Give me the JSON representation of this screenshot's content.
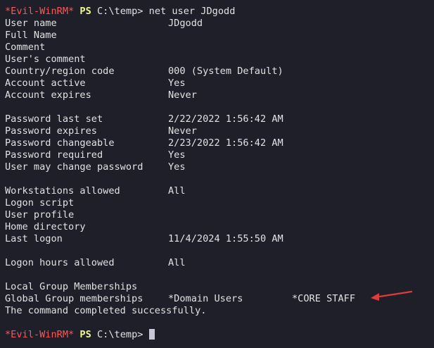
{
  "prompt": {
    "host": "*Evil-WinRM*",
    "shell": "PS",
    "path": "C:\\temp>"
  },
  "command": "net user JDgodd",
  "rows": [
    {
      "label": "User name",
      "value": "JDgodd"
    },
    {
      "label": "Full Name",
      "value": ""
    },
    {
      "label": "Comment",
      "value": ""
    },
    {
      "label": "User's comment",
      "value": ""
    },
    {
      "label": "Country/region code",
      "value": "000 (System Default)"
    },
    {
      "label": "Account active",
      "value": "Yes"
    },
    {
      "label": "Account expires",
      "value": "Never"
    },
    {
      "label": "",
      "value": ""
    },
    {
      "label": "Password last set",
      "value": "2/22/2022 1:56:42 AM"
    },
    {
      "label": "Password expires",
      "value": "Never"
    },
    {
      "label": "Password changeable",
      "value": "2/23/2022 1:56:42 AM"
    },
    {
      "label": "Password required",
      "value": "Yes"
    },
    {
      "label": "User may change password",
      "value": "Yes"
    },
    {
      "label": "",
      "value": ""
    },
    {
      "label": "Workstations allowed",
      "value": "All"
    },
    {
      "label": "Logon script",
      "value": ""
    },
    {
      "label": "User profile",
      "value": ""
    },
    {
      "label": "Home directory",
      "value": ""
    },
    {
      "label": "Last logon",
      "value": "11/4/2024 1:55:50 AM"
    },
    {
      "label": "",
      "value": ""
    },
    {
      "label": "Logon hours allowed",
      "value": "All"
    },
    {
      "label": "",
      "value": ""
    },
    {
      "label": "Local Group Memberships",
      "value": ""
    },
    {
      "label": "Global Group memberships",
      "value": "*Domain Users",
      "value2": "*CORE STAFF"
    }
  ],
  "completion": "The command completed successfully.",
  "colors": {
    "background": "#1e1f29",
    "text": "#e2e2e2",
    "prompt_host": "#ff5555",
    "prompt_shell": "#f1fa8c",
    "annotation_arrow": "#e03a3a"
  },
  "annotation": {
    "icon": "red-arrow-icon",
    "points_to": "*CORE STAFF"
  }
}
